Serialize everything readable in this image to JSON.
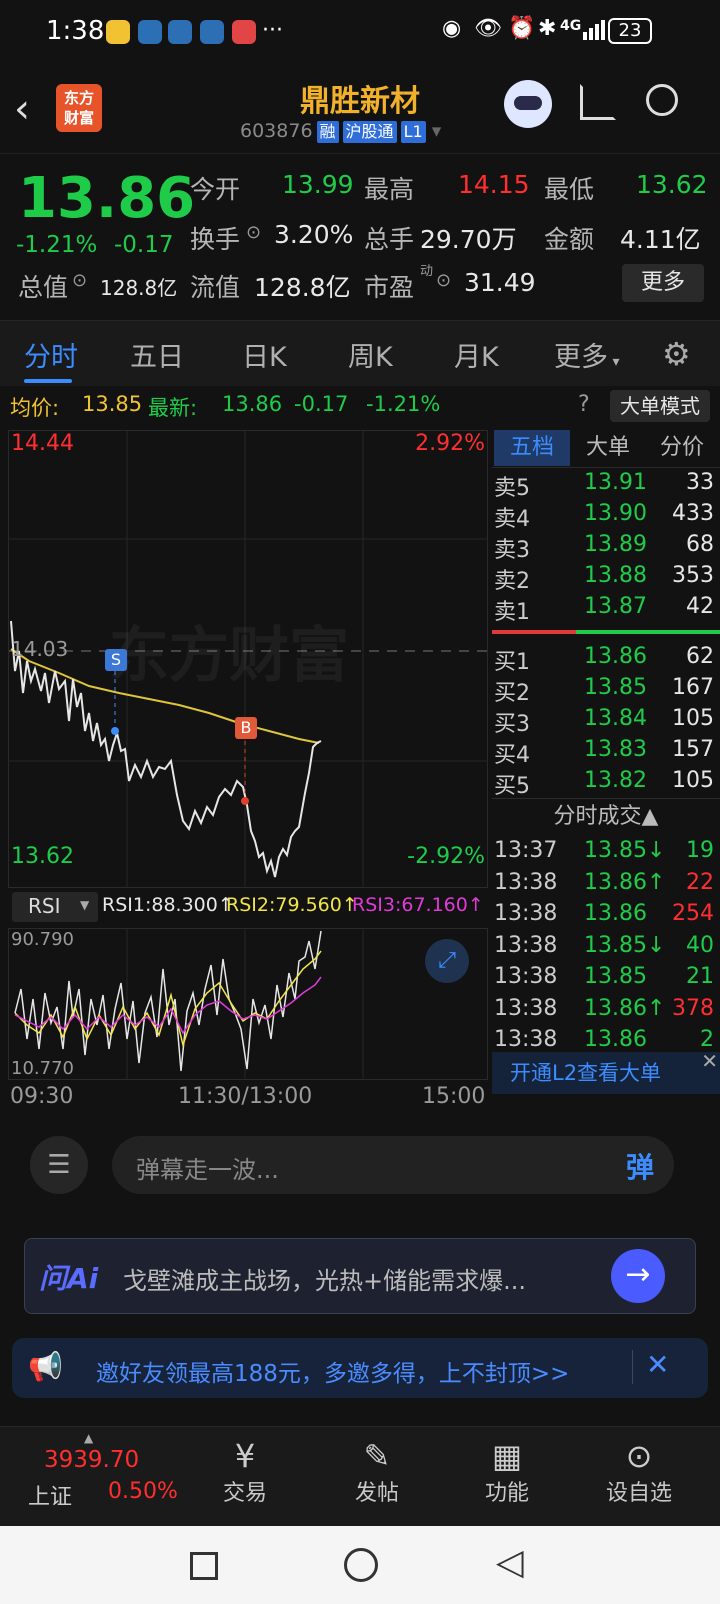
{
  "status_bar": {
    "time": "1:38",
    "battery": "23",
    "network": "4G"
  },
  "header": {
    "logo": "东方\n财富",
    "title": "鼎胜新材",
    "code": "603876",
    "tags": [
      "融",
      "沪股通",
      "L1"
    ]
  },
  "quote": {
    "price": "13.86",
    "change_pct": "-1.21%",
    "change": "-0.17",
    "open_label": "今开",
    "open": "13.99",
    "high_label": "最高",
    "high": "14.15",
    "low_label": "最低",
    "low": "13.62",
    "turnover_label": "换手",
    "turnover": "3.20%",
    "volume_label": "总手",
    "volume": "29.70万",
    "amount_label": "金额",
    "amount": "4.11亿",
    "mcap_label": "总值",
    "mcap": "128.8亿",
    "float_label": "流值",
    "float_value": "128.8亿",
    "pe_label": "市盈",
    "pe_sup": "动",
    "pe": "31.49",
    "more_label": "更多"
  },
  "tabs": [
    "分时",
    "五日",
    "日K",
    "周K",
    "月K",
    "更多"
  ],
  "avg_bar": {
    "avg_label": "均价:",
    "avg": "13.85",
    "latest_label": "最新:",
    "latest": "13.86",
    "chg": "-0.17",
    "pct": "-1.21%",
    "mode": "大单模式"
  },
  "chart": {
    "top_price": "14.44",
    "top_pct": "2.92%",
    "mid_price": "14.03",
    "bottom_price": "13.62",
    "bottom_pct": "-2.92%",
    "markers": [
      "S",
      "B"
    ],
    "watermark": "东方财富"
  },
  "chart_data": {
    "type": "line",
    "x": [
      "09:30",
      "11:30/13:00",
      "15:00"
    ],
    "ylim": [
      13.62,
      14.44
    ],
    "series": [],
    "ref_price": 14.03
  },
  "rsi": {
    "label": "RSI",
    "rsi1": "RSI1:88.300↑",
    "rsi2": "RSI2:79.560↑",
    "rsi3": "RSI3:67.160↑",
    "max": "90.790",
    "min": "10.770"
  },
  "time_axis": [
    "09:30",
    "11:30/13:00",
    "15:00"
  ],
  "book": {
    "tabs": [
      "五档",
      "大单",
      "分价"
    ],
    "asks": [
      [
        "卖5",
        "13.91",
        "33"
      ],
      [
        "卖4",
        "13.90",
        "433"
      ],
      [
        "卖3",
        "13.89",
        "68"
      ],
      [
        "卖2",
        "13.88",
        "353"
      ],
      [
        "卖1",
        "13.87",
        "42"
      ]
    ],
    "bids": [
      [
        "买1",
        "13.86",
        "62"
      ],
      [
        "买2",
        "13.85",
        "167"
      ],
      [
        "买3",
        "13.84",
        "105"
      ],
      [
        "买4",
        "13.83",
        "157"
      ],
      [
        "买5",
        "13.82",
        "105"
      ]
    ],
    "trades_title": "分时成交▲",
    "trades": [
      [
        "13:37",
        "13.85↓",
        "19",
        "g"
      ],
      [
        "13:38",
        "13.86↑",
        "22",
        "r"
      ],
      [
        "13:38",
        "13.86",
        "254",
        "r"
      ],
      [
        "13:38",
        "13.85↓",
        "40",
        "g"
      ],
      [
        "13:38",
        "13.85",
        "21",
        "g"
      ],
      [
        "13:38",
        "13.86↑",
        "378",
        "r"
      ],
      [
        "13:38",
        "13.86",
        "2",
        "g"
      ]
    ],
    "l2_promo": "开通L2查看大单"
  },
  "danmu": {
    "placeholder": "弹幕走一波...",
    "btn": "弹"
  },
  "ai": {
    "label": "问Ai",
    "text": "戈壁滩成主战场，光热+储能需求爆..."
  },
  "promo": {
    "text": "邀好友领最高188元，多邀多得，上不封顶>>"
  },
  "bottom_nav": {
    "index_value": "3939.70",
    "index_name": "上证",
    "index_pct": "0.50%",
    "items": [
      "交易",
      "发帖",
      "功能",
      "设自选"
    ]
  }
}
